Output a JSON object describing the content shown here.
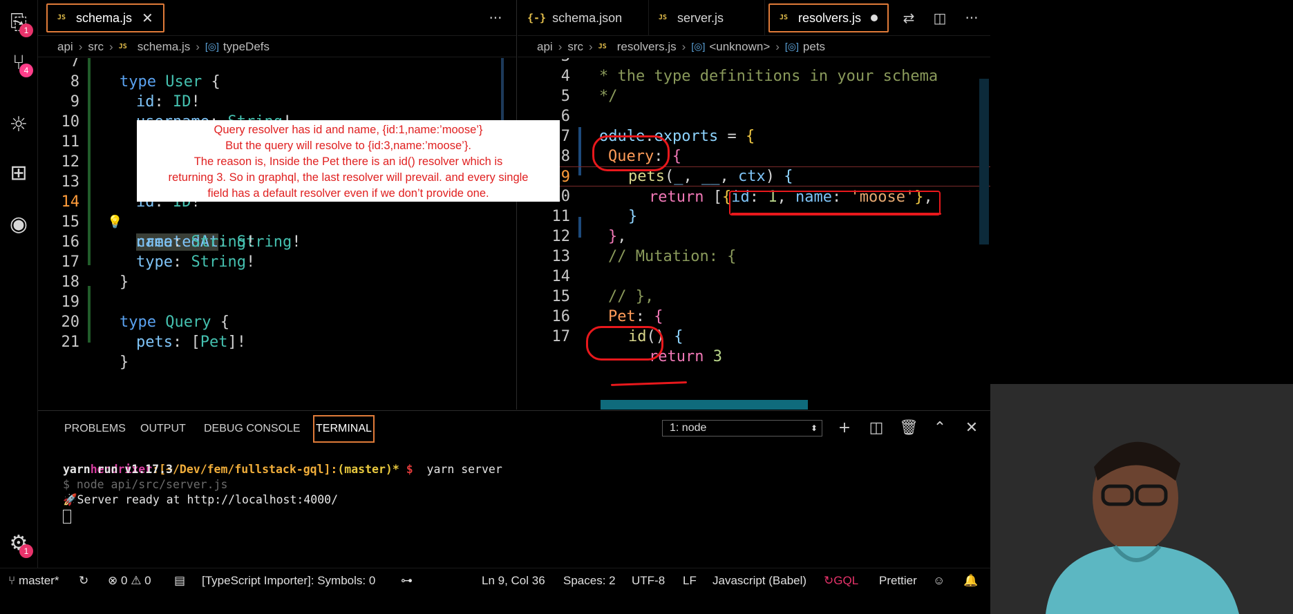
{
  "activity_bar": {
    "items": [
      {
        "icon": "files-icon",
        "glyph": "⎘",
        "badge": "1"
      },
      {
        "icon": "source-control-icon",
        "glyph": "⑂",
        "badge": "4"
      },
      {
        "icon": "debug-icon",
        "glyph": "☼",
        "badge": ""
      },
      {
        "icon": "extensions-icon",
        "glyph": "⊞",
        "badge": ""
      },
      {
        "icon": "spotify-icon",
        "glyph": "◉",
        "badge": ""
      }
    ],
    "settings_badge": "1"
  },
  "left_editor": {
    "tab_label": "schema.js",
    "breadcrumb": [
      "api",
      "src",
      "schema.js",
      "typeDefs"
    ],
    "lines": [
      {
        "n": "7",
        "text": "type User {"
      },
      {
        "n": "8",
        "text": "id: ID!"
      },
      {
        "n": "9",
        "text": "username: String!"
      },
      {
        "n": "10",
        "text": ""
      },
      {
        "n": "11",
        "text": ""
      },
      {
        "n": "12",
        "text": ""
      },
      {
        "n": "13",
        "text": "id: ID!"
      },
      {
        "n": "14",
        "text": "createdAt: String!"
      },
      {
        "n": "15",
        "text": "name: String!"
      },
      {
        "n": "16",
        "text": "type: String!"
      },
      {
        "n": "17",
        "text": "}"
      },
      {
        "n": "18",
        "text": ""
      },
      {
        "n": "19",
        "text": "type Query {"
      },
      {
        "n": "20",
        "text": "pets: [Pet]!"
      },
      {
        "n": "21",
        "text": "}"
      }
    ]
  },
  "right_editor": {
    "tabs": [
      {
        "label": "schema.json",
        "icon": "{-}"
      },
      {
        "label": "server.js",
        "icon": "JS"
      },
      {
        "label": "resolvers.js",
        "icon": "JS"
      }
    ],
    "breadcrumb": [
      "api",
      "src",
      "resolvers.js",
      "<unknown>",
      "pets"
    ],
    "lines": [
      {
        "n": "3",
        "text": "* the type definitions in your schema"
      },
      {
        "n": "4",
        "text": "*/"
      },
      {
        "n": "5",
        "text": ""
      },
      {
        "n": "6",
        "text": "odule.exports = {"
      },
      {
        "n": "7",
        "text": "Query: {"
      },
      {
        "n": "8",
        "text": "pets(_, __, ctx) {"
      },
      {
        "n": "9",
        "text": "return [{id: 1, name: 'moose'},"
      },
      {
        "n": "10",
        "text": "}"
      },
      {
        "n": "11",
        "text": "},"
      },
      {
        "n": "12",
        "text": "// Mutation: {"
      },
      {
        "n": "13",
        "text": ""
      },
      {
        "n": "14",
        "text": "// },"
      },
      {
        "n": "15",
        "text": "Pet: {"
      },
      {
        "n": "16",
        "text": "id() {"
      },
      {
        "n": "17",
        "text": "return 3"
      }
    ]
  },
  "note": {
    "line1": "Query resolver has id and name, {id:1,name:’moose’}",
    "line2": "But the query will resolve to {id:3,name:’moose’}.",
    "line3": "The reason is, Inside the Pet there is an id() resolver which is",
    "line4": "returning 3. So in graphql, the last resolver will prevail. and every single",
    "line5": "field has a default resolver even if we don’t provide one."
  },
  "panel": {
    "tabs": [
      "PROBLEMS",
      "OUTPUT",
      "DEBUG CONSOLE",
      "TERMINAL"
    ],
    "active_tab": "TERMINAL",
    "terminal_select": "1: node",
    "terminal": {
      "prompt_user": "hendrixer",
      "prompt_path": ":[~/Dev/fem/fullstack-gql]:",
      "prompt_branch": "(master)*",
      "prompt_dollar": " $",
      "command": "  yarn server",
      "line2": "yarn run v1.17.3",
      "line3": "$ node api/src/server.js",
      "line4": "🚀Server ready at http://localhost:4000/"
    }
  },
  "status_bar": {
    "branch": "master*",
    "errors": "0",
    "warnings": "0",
    "importer": "[TypeScript Importer]: Symbols: 0",
    "position": "Ln 9, Col 36",
    "spaces": "Spaces: 2",
    "encoding": "UTF-8",
    "eol": "LF",
    "language": "Javascript (Babel)",
    "gql": "GQL",
    "prettier": "Prettier"
  },
  "colors": {
    "annotation_red": "#e8181c",
    "tab_outline": "#e07b39",
    "badge_pink": "#e8336b"
  }
}
